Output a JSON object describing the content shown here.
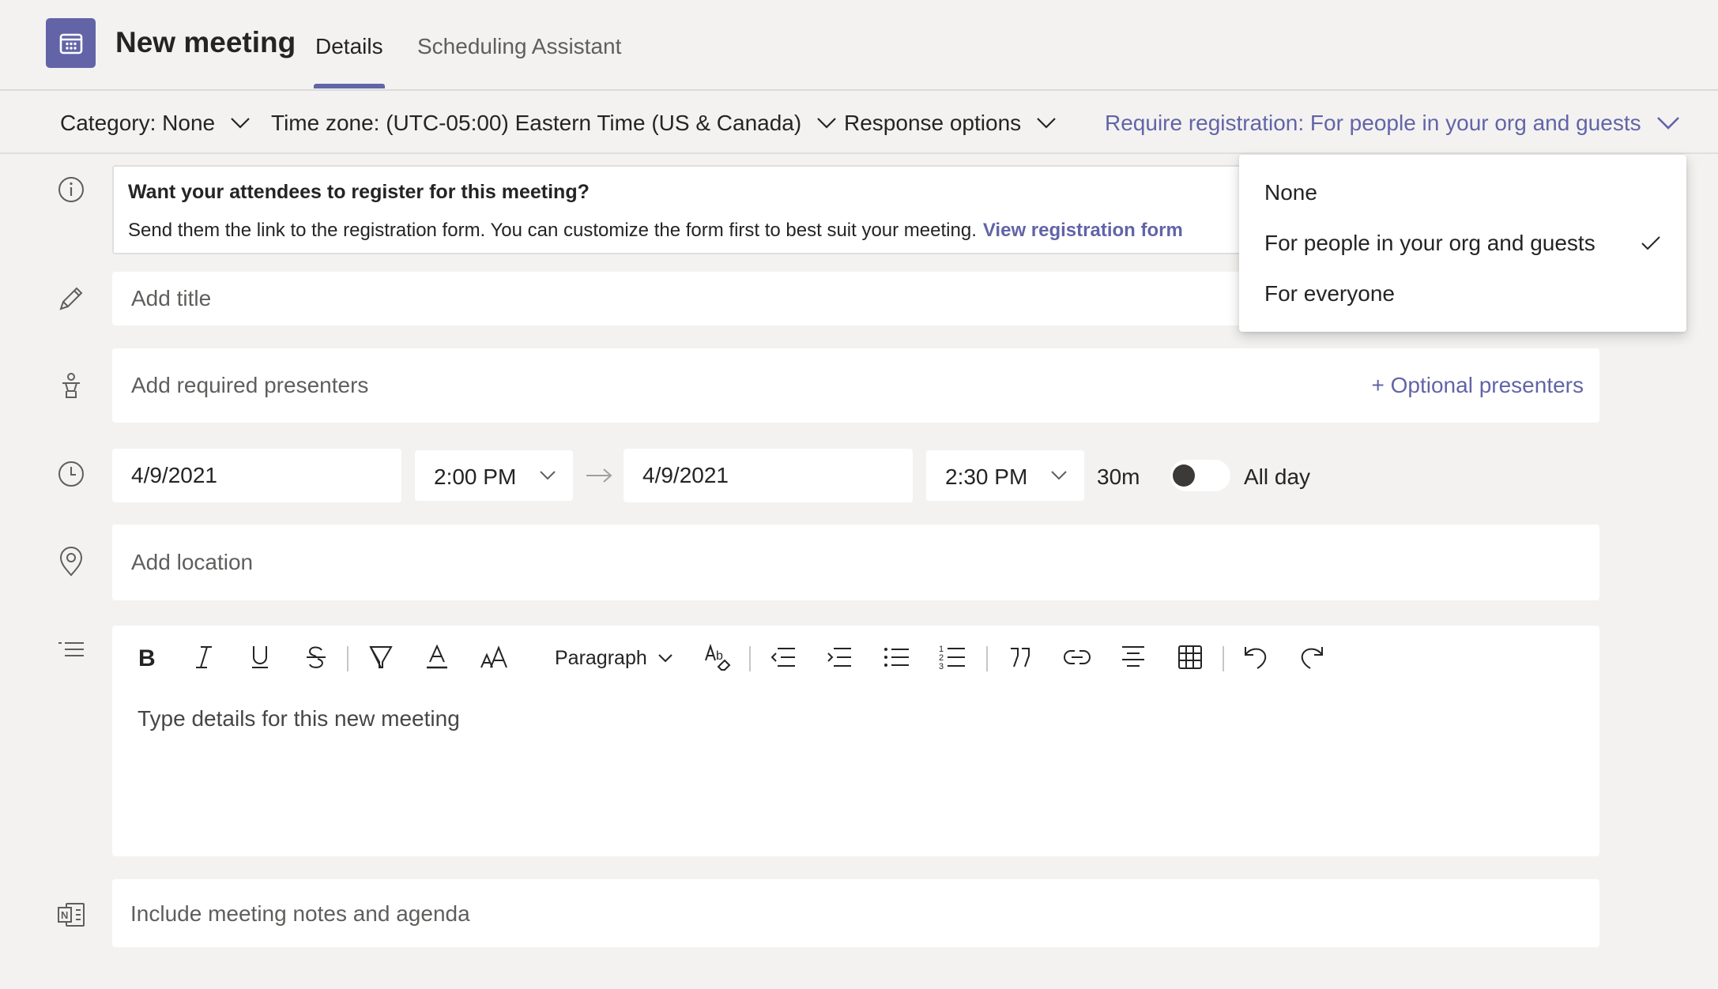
{
  "header": {
    "title": "New meeting",
    "tabs": [
      {
        "label": "Details",
        "active": true
      },
      {
        "label": "Scheduling Assistant",
        "active": false
      }
    ]
  },
  "options_bar": {
    "category": "Category: None",
    "timezone": "Time zone: (UTC-05:00) Eastern Time (US & Canada)",
    "response": "Response options",
    "registration": "Require registration: For people in your org and guests"
  },
  "banner": {
    "title": "Want your attendees to register for this meeting?",
    "text": "Send them the link to the registration form. You can customize the form first to best suit your meeting.",
    "link": "View registration form"
  },
  "form": {
    "title_placeholder": "Add title",
    "presenters_placeholder": "Add required presenters",
    "optional_presenters": "+ Optional presenters",
    "start_date": "4/9/2021",
    "start_time": "2:00 PM",
    "end_date": "4/9/2021",
    "end_time": "2:30 PM",
    "duration": "30m",
    "all_day_label": "All day",
    "all_day": false,
    "location_placeholder": "Add location",
    "details_placeholder": "Type details for this new meeting",
    "notes_placeholder": "Include meeting notes and agenda"
  },
  "editor_toolbar": {
    "paragraph": "Paragraph",
    "buttons": [
      "bold-icon",
      "italic-icon",
      "underline-icon",
      "strikethrough-icon",
      "highlight-icon",
      "font-color-icon",
      "font-size-icon",
      "paragraph-style",
      "clear-format-icon",
      "decrease-indent-icon",
      "increase-indent-icon",
      "bulleted-list-icon",
      "numbered-list-icon",
      "quote-icon",
      "link-icon",
      "align-icon",
      "table-icon",
      "undo-icon",
      "redo-icon"
    ]
  },
  "registration_dropdown": {
    "items": [
      {
        "label": "None",
        "selected": false
      },
      {
        "label": "For people in your org and guests",
        "selected": true
      },
      {
        "label": "For everyone",
        "selected": false
      }
    ]
  },
  "colors": {
    "accent": "#6264a7",
    "background": "#f3f2f1",
    "field": "#ffffff",
    "text": "#252423"
  }
}
